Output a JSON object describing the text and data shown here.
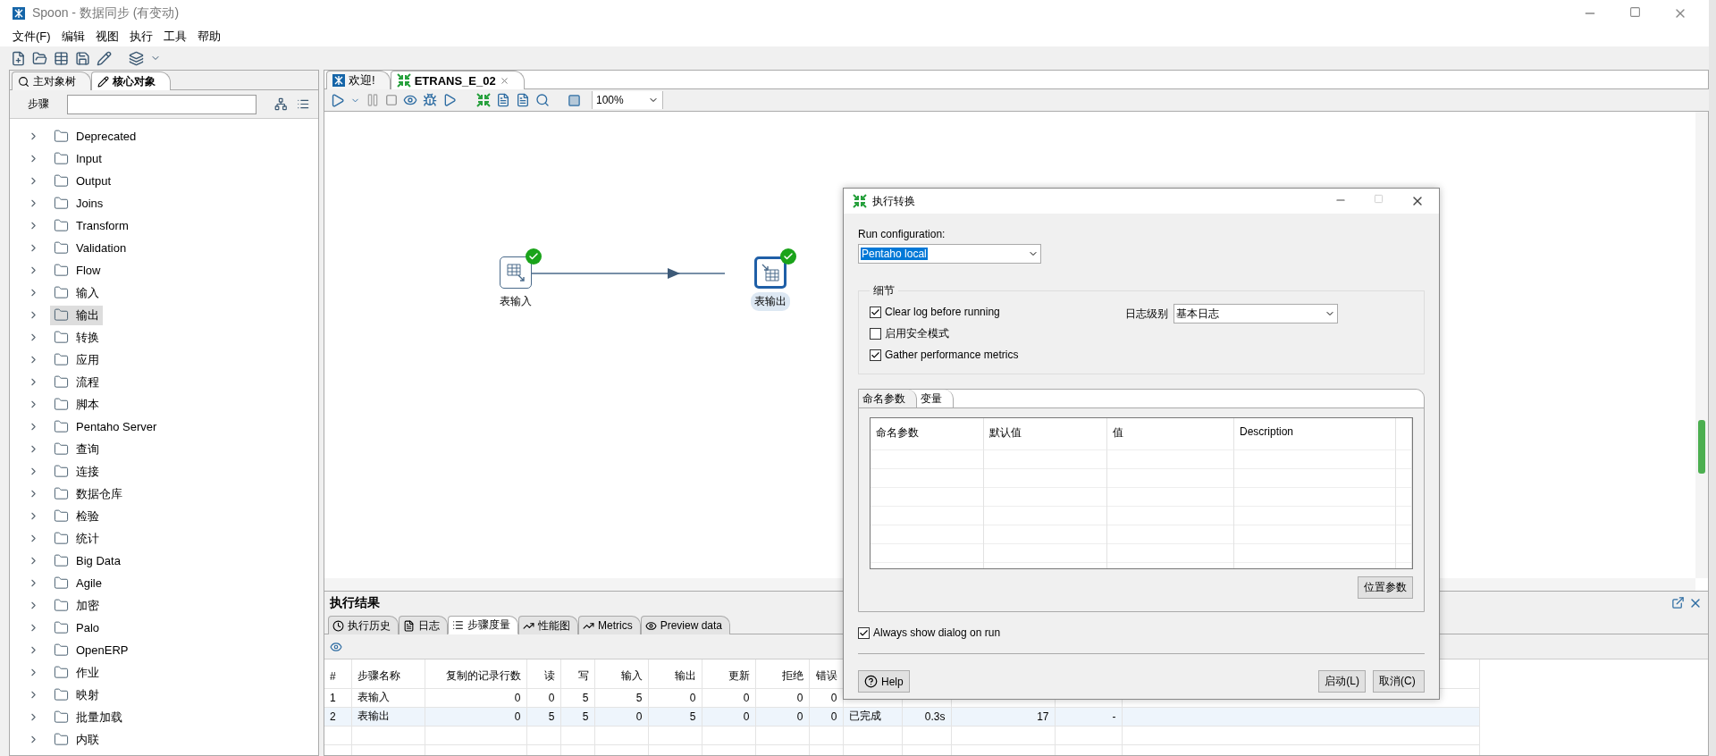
{
  "window": {
    "title": "Spoon - 数据同步 (有变动)"
  },
  "menu": [
    "文件(F)",
    "编辑",
    "视图",
    "执行",
    "工具",
    "帮助"
  ],
  "left_panel": {
    "tabs": [
      {
        "label": "主对象树",
        "selected": false,
        "kind": "tree"
      },
      {
        "label": "核心对象",
        "selected": true,
        "kind": "core"
      }
    ],
    "search_label": "步骤",
    "tree": [
      {
        "label": "Deprecated",
        "selected": false
      },
      {
        "label": "Input",
        "selected": false
      },
      {
        "label": "Output",
        "selected": false
      },
      {
        "label": "Joins",
        "selected": false
      },
      {
        "label": "Transform",
        "selected": false
      },
      {
        "label": "Validation",
        "selected": false
      },
      {
        "label": "Flow",
        "selected": false
      },
      {
        "label": "输入",
        "selected": false
      },
      {
        "label": "输出",
        "selected": true
      },
      {
        "label": "转换",
        "selected": false
      },
      {
        "label": "应用",
        "selected": false
      },
      {
        "label": "流程",
        "selected": false
      },
      {
        "label": "脚本",
        "selected": false
      },
      {
        "label": "Pentaho Server",
        "selected": false
      },
      {
        "label": "查询",
        "selected": false
      },
      {
        "label": "连接",
        "selected": false
      },
      {
        "label": "数据仓库",
        "selected": false
      },
      {
        "label": "检验",
        "selected": false
      },
      {
        "label": "统计",
        "selected": false
      },
      {
        "label": "Big Data",
        "selected": false
      },
      {
        "label": "Agile",
        "selected": false
      },
      {
        "label": "加密",
        "selected": false
      },
      {
        "label": "Palo",
        "selected": false
      },
      {
        "label": "OpenERP",
        "selected": false
      },
      {
        "label": "作业",
        "selected": false
      },
      {
        "label": "映射",
        "selected": false
      },
      {
        "label": "批量加载",
        "selected": false
      },
      {
        "label": "内联",
        "selected": false
      }
    ]
  },
  "editor_tabs": [
    {
      "label": "欢迎!",
      "selected": false,
      "kind": "welcome"
    },
    {
      "label": "ETRANS_E_02",
      "selected": true,
      "kind": "transformation"
    }
  ],
  "zoom": "100%",
  "canvas": {
    "steps": [
      {
        "label": "表输入",
        "selected": false,
        "kind": "input"
      },
      {
        "label": "表输出",
        "selected": true,
        "kind": "output"
      }
    ]
  },
  "results": {
    "title": "执行结果",
    "tabs": [
      {
        "label": "执行历史",
        "selected": false,
        "kind": "history"
      },
      {
        "label": "日志",
        "selected": false,
        "kind": "log"
      },
      {
        "label": "步骤度量",
        "selected": true,
        "kind": "metrics"
      },
      {
        "label": "性能图",
        "selected": false,
        "kind": "chart"
      },
      {
        "label": "Metrics",
        "selected": false,
        "kind": "chart"
      },
      {
        "label": "Preview data",
        "selected": false,
        "kind": "preview"
      }
    ],
    "columns": [
      "#",
      "步骤名称",
      "复制的记录行数",
      "读",
      "写",
      "输入",
      "输出",
      "更新",
      "拒绝",
      "错误"
    ],
    "rows": [
      {
        "cells": [
          "1",
          "表输入",
          "0",
          "0",
          "5",
          "5",
          "0",
          "0",
          "0",
          "0"
        ]
      },
      {
        "cells": [
          "2",
          "表输出",
          "0",
          "5",
          "5",
          "0",
          "5",
          "0",
          "0",
          "0",
          "已完成",
          "0.3s",
          "17",
          "-"
        ]
      }
    ]
  },
  "dialog": {
    "title": "执行转换",
    "run_config": {
      "label": "Run configuration:",
      "value": "Pentaho local"
    },
    "details": {
      "title": "细节",
      "options": [
        {
          "label": "Clear log before running",
          "checked": true
        },
        {
          "label": "启用安全模式",
          "checked": false
        },
        {
          "label": "Gather performance metrics",
          "checked": true
        }
      ],
      "log_level": {
        "label": "日志级别",
        "value": "基本日志"
      }
    },
    "tabs": [
      {
        "label": "命名参数",
        "selected": true
      },
      {
        "label": "变量",
        "selected": false
      }
    ],
    "columns": [
      "命名参数",
      "默认值",
      "值",
      "Description"
    ],
    "positional_button": "位置参数",
    "always_show": {
      "label": "Always show dialog on run",
      "checked": true
    },
    "help_button": "Help",
    "start_button": "启动(L)",
    "cancel_button": "取消(C)"
  }
}
